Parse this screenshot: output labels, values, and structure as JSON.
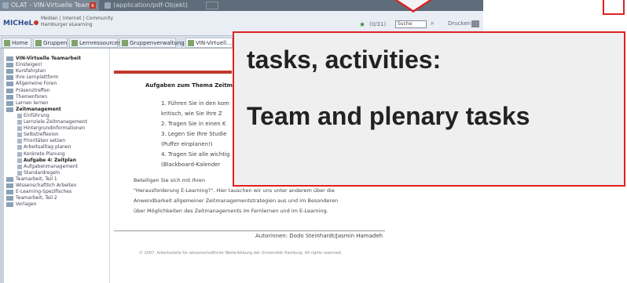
{
  "browser": {
    "tabs": [
      {
        "label": "OLAT - VIN-Virtuelle Team..."
      },
      {
        "label": "(application/pdf-Objekt)"
      }
    ],
    "close_label": "x"
  },
  "header": {
    "logo": "MICHeL",
    "portal_lines": [
      "Medien | Internet | Community",
      "Hamburger eLearning"
    ],
    "count": "(0/31)",
    "search_value": "Suche",
    "print_label": "Drucken",
    "icons": {
      "star": "star-icon",
      "search": "search-icon",
      "print": "printer-icon"
    }
  },
  "nav": {
    "tabs": [
      {
        "label": "Home"
      },
      {
        "label": "Gruppen"
      },
      {
        "label": "Lernressourcen"
      },
      {
        "label": "Gruppenverwaltung"
      },
      {
        "label": "VIN-Virtuell..."
      }
    ]
  },
  "sidebar": {
    "items": [
      {
        "label": "VIN-Virtuelle Teamarbeit",
        "level": 0,
        "bold": true
      },
      {
        "label": "Einsteigen!",
        "level": 0
      },
      {
        "label": "Kursfahrplan",
        "level": 0
      },
      {
        "label": "Ihre Lernplattform",
        "level": 0
      },
      {
        "label": "Allgemeine Foren",
        "level": 0
      },
      {
        "label": "Präsenztreffen",
        "level": 0
      },
      {
        "label": "Themenforen",
        "level": 0
      },
      {
        "label": "Lernen lernen",
        "level": 0
      },
      {
        "label": "Zeitmanagement",
        "level": 0,
        "bold": true
      },
      {
        "label": "Einführung",
        "level": 1
      },
      {
        "label": "Lernziele Zeitmanagement",
        "level": 1
      },
      {
        "label": "Hintergrundinformationen",
        "level": 1
      },
      {
        "label": "Selbstreflexion",
        "level": 1
      },
      {
        "label": "Prioritäten setzen",
        "level": 1
      },
      {
        "label": "Arbeitsalltag planen",
        "level": 1
      },
      {
        "label": "Konkrete Planung",
        "level": 1
      },
      {
        "label": "Aufgabe 4: Zeitplan",
        "level": 1,
        "bold": true
      },
      {
        "label": "Aufgabenmanagement",
        "level": 1
      },
      {
        "label": "Standardregeln",
        "level": 1
      },
      {
        "label": "Teamarbeit, Teil 1",
        "level": 0
      },
      {
        "label": "Wissenschaftlich Arbeiten",
        "level": 0
      },
      {
        "label": "E-Learning-Spezifisches",
        "level": 0
      },
      {
        "label": "Teamarbeit, Teil 2",
        "level": 0
      },
      {
        "label": "Vorlagen",
        "level": 0
      }
    ]
  },
  "content": {
    "title": "Aufgaben zum Thema Zeitm",
    "steps": [
      "1.  Führen Sie in den kom",
      "     kritisch, wie Sie Ihre Z",
      "2.  Tragen Sie in einen K",
      "3.  Legen Sie Ihre Studie",
      "     (Puffer einplanen!)",
      "4.  Tragen Sie alle wichtig",
      "     (Blackboard-Kalender"
    ],
    "paragraph": [
      "Beteiligen Sie sich mit Ihren",
      "\"Herausforderung E-Learning?\". Hier tauschen wir uns unter anderem über die",
      "Anwendbarkeit allgemeiner Zeitmanagementstrategien aus und im Besonderen",
      "über Möglichkeiten des Zeitmanagements im Fernlernen und im E-Learning."
    ],
    "authors": "Autorinnen: Dodo Steinhardt/Jasmin Hamadeh",
    "footer": "© 2007, Arbeitsstelle für wissenschaftliche Weiterbildung der Universität Hamburg. All rights reserved."
  },
  "callout": {
    "line1": "tasks, activities:",
    "line2": "Team and plenary tasks"
  },
  "colors": {
    "accent_red": "#e02020",
    "olat_red": "#c0392b"
  }
}
